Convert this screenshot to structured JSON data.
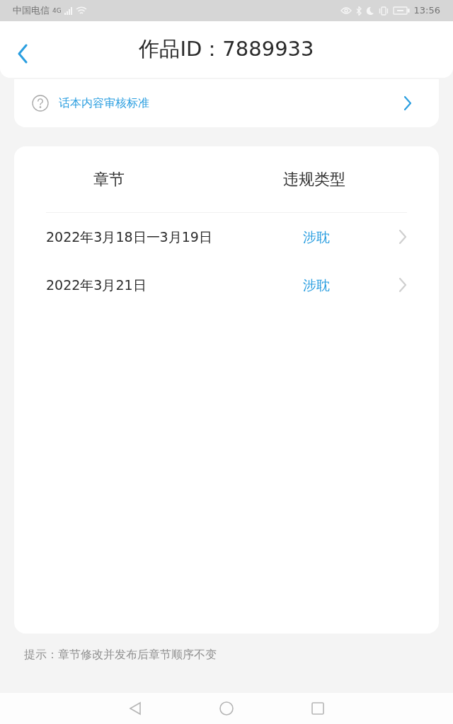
{
  "status_bar": {
    "carrier": "中国电信",
    "network": "4G",
    "time": "13:56"
  },
  "header": {
    "title": "作品ID：7889933"
  },
  "guidelines_link": {
    "label": "话本内容审核标准"
  },
  "table": {
    "columns": [
      "章节",
      "违规类型"
    ],
    "rows": [
      {
        "chapter": "2022年3月18日一3月19日",
        "violation": "涉耽"
      },
      {
        "chapter": "2022年3月21日",
        "violation": "涉耽"
      }
    ]
  },
  "hint": "提示：章节修改并发布后章节顺序不变"
}
